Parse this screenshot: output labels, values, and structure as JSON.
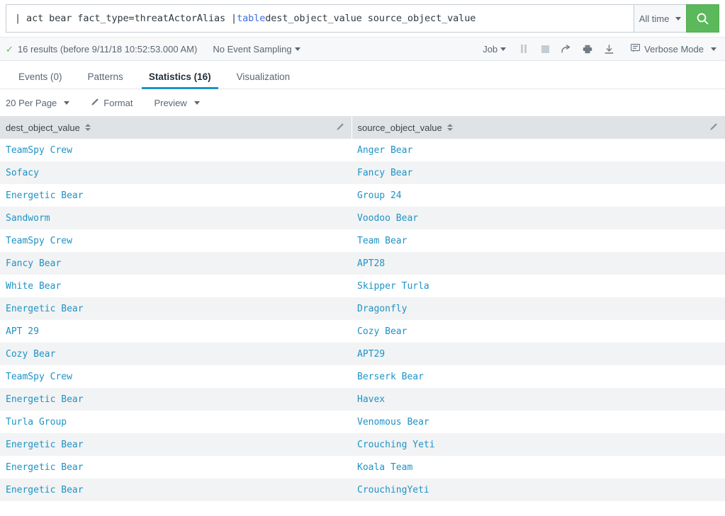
{
  "search": {
    "query_prefix": "| act bear fact_type=threatActorAlias | ",
    "query_keyword": "table",
    "query_suffix": " dest_object_value source_object_value",
    "full_query": "| act bear fact_type=threatActorAlias | table dest_object_value source_object_value",
    "time_range_label": "All time",
    "submit_icon": "search-icon",
    "accent_green": "#5bb85b",
    "keyword_color": "#3b6ee0"
  },
  "infobar": {
    "results_text": "16 results (before 9/11/18 10:52:53.000 AM)",
    "check_icon": "check-icon",
    "sampling_label": "No Event Sampling",
    "job_label": "Job",
    "controls": [
      {
        "name": "pause-icon",
        "state": "disabled"
      },
      {
        "name": "stop-icon",
        "state": "disabled"
      },
      {
        "name": "share-icon",
        "state": "enabled"
      },
      {
        "name": "print-icon",
        "state": "enabled"
      },
      {
        "name": "export-icon",
        "state": "enabled"
      }
    ],
    "mode_label": "Verbose Mode",
    "mode_icon": "list-box-icon"
  },
  "tabs": [
    {
      "label": "Events (0)",
      "active": false
    },
    {
      "label": "Patterns",
      "active": false
    },
    {
      "label": "Statistics (16)",
      "active": true
    },
    {
      "label": "Visualization",
      "active": false
    }
  ],
  "results_toolbar": {
    "per_page_label": "20 Per Page",
    "format_label": "Format",
    "format_icon": "pencil-icon",
    "preview_label": "Preview"
  },
  "table": {
    "columns": [
      {
        "label": "dest_object_value",
        "sort_icon": "sort-arrows-icon",
        "edit_icon": "pencil-icon"
      },
      {
        "label": "source_object_value",
        "sort_icon": "sort-arrows-icon",
        "edit_icon": "pencil-icon"
      }
    ],
    "rows": [
      [
        "TeamSpy Crew",
        "Anger Bear"
      ],
      [
        "Sofacy",
        "Fancy Bear"
      ],
      [
        "Energetic Bear",
        "Group 24"
      ],
      [
        "Sandworm",
        "Voodoo Bear"
      ],
      [
        "TeamSpy Crew",
        "Team Bear"
      ],
      [
        "Fancy Bear",
        "APT28"
      ],
      [
        "White Bear",
        "Skipper Turla"
      ],
      [
        "Energetic Bear",
        "Dragonfly"
      ],
      [
        "APT 29",
        "Cozy Bear"
      ],
      [
        "Cozy Bear",
        "APT29"
      ],
      [
        "TeamSpy Crew",
        "Berserk Bear"
      ],
      [
        "Energetic Bear",
        "Havex"
      ],
      [
        "Turla Group",
        "Venomous Bear"
      ],
      [
        "Energetic Bear",
        "Crouching Yeti"
      ],
      [
        "Energetic Bear",
        "Koala Team"
      ],
      [
        "Energetic Bear",
        "CrouchingYeti"
      ]
    ]
  }
}
